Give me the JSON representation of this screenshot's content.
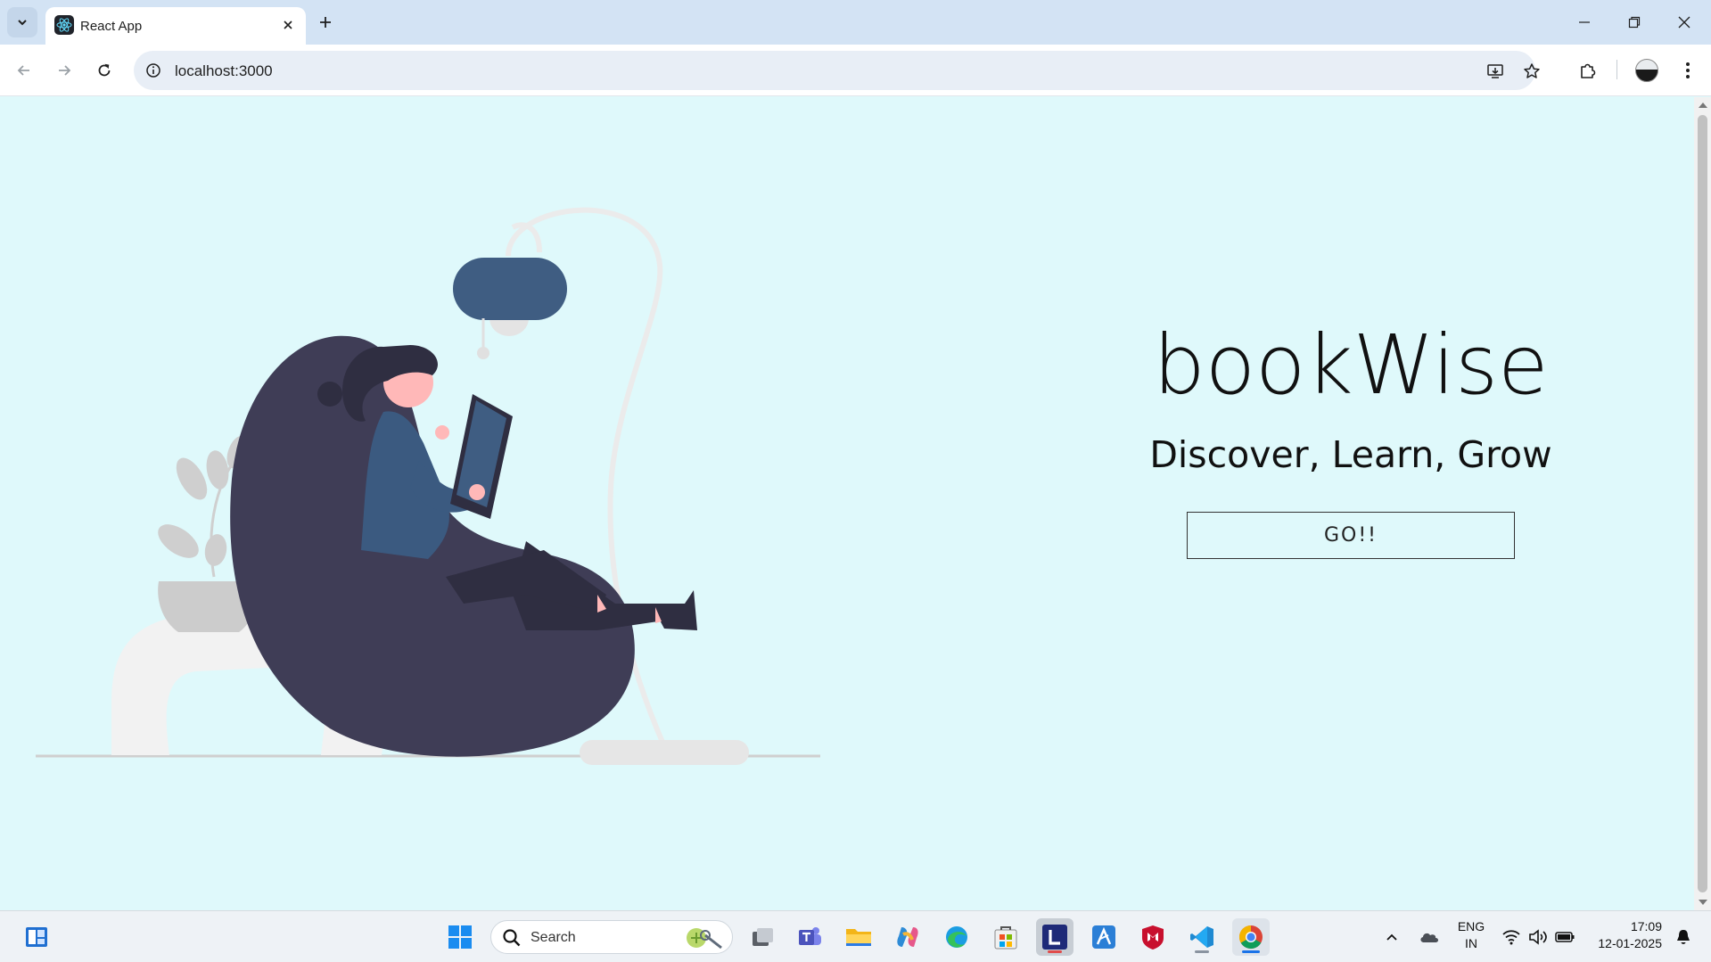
{
  "browser": {
    "tab": {
      "title": "React App",
      "favicon": "react-icon"
    },
    "address": {
      "url": "localhost:3000"
    },
    "icons": {
      "tab_search": "chevron-down-icon",
      "new_tab": "plus-icon",
      "minimize": "minimize-icon",
      "restore": "restore-icon",
      "close": "close-icon",
      "back": "back-arrow-icon",
      "forward": "forward-arrow-icon",
      "reload": "reload-icon",
      "site_info": "info-icon",
      "install": "install-app-icon",
      "bookmark": "star-icon",
      "extensions": "puzzle-icon",
      "menu": "kebab-menu-icon"
    }
  },
  "page": {
    "brand": "bookWise",
    "tagline": "Discover, Learn, Grow",
    "cta_label": "GO!!",
    "colors": {
      "background": "#dff9fb",
      "text": "#111111",
      "illustration_dark": "#3f3d56",
      "illustration_blue": "#3b5a80"
    }
  },
  "taskbar": {
    "search_placeholder": "Search",
    "language": {
      "line1": "ENG",
      "line2": "IN"
    },
    "clock": {
      "time": "17:09",
      "date": "12-01-2025"
    },
    "apps": [
      "widgets",
      "start",
      "search",
      "task-view",
      "teams",
      "file-explorer",
      "copilot",
      "edge",
      "store",
      "l-app",
      "azure-data-studio",
      "mcafee",
      "vscode",
      "chrome"
    ]
  }
}
